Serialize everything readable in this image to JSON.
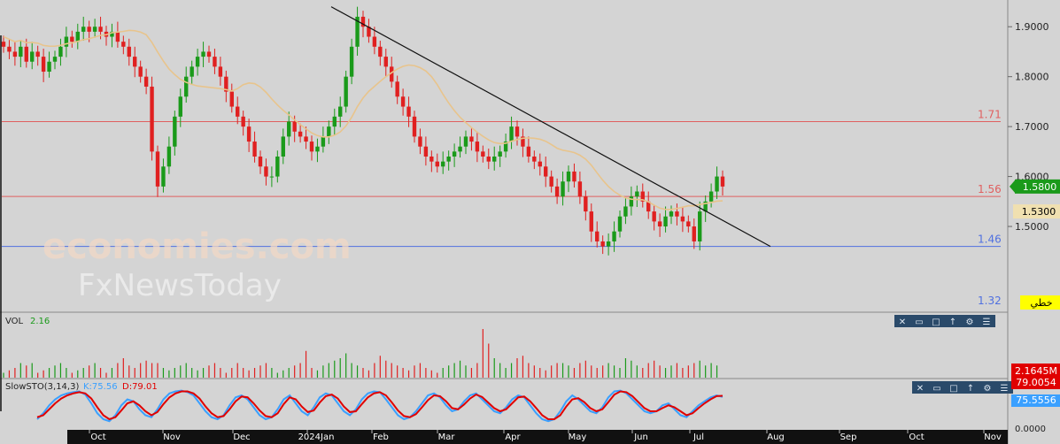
{
  "chart_data": {
    "type": "candlestick",
    "title": "",
    "price_axis": {
      "range": [
        1.33,
        1.95
      ],
      "ticks": [
        "1.9000",
        "1.8000",
        "1.7000",
        "1.6000",
        "1.5000"
      ],
      "tick_values": [
        1.9,
        1.8,
        1.7,
        1.6,
        1.5
      ]
    },
    "time_axis": {
      "labels": [
        "Oct",
        "Nov",
        "Dec",
        "2024Jan",
        "Feb",
        "Mar",
        "Apr",
        "May",
        "Jun",
        "Jul",
        "Aug",
        "Sep",
        "Oct",
        "Nov"
      ]
    },
    "candle_closes_approx": [
      1.86,
      1.85,
      1.84,
      1.86,
      1.83,
      1.85,
      1.84,
      1.81,
      1.83,
      1.84,
      1.86,
      1.88,
      1.87,
      1.89,
      1.9,
      1.89,
      1.9,
      1.89,
      1.88,
      1.89,
      1.87,
      1.86,
      1.84,
      1.82,
      1.8,
      1.78,
      1.65,
      1.58,
      1.62,
      1.66,
      1.72,
      1.76,
      1.8,
      1.82,
      1.84,
      1.85,
      1.84,
      1.82,
      1.8,
      1.77,
      1.74,
      1.72,
      1.7,
      1.67,
      1.64,
      1.62,
      1.6,
      1.6,
      1.64,
      1.68,
      1.71,
      1.69,
      1.68,
      1.67,
      1.65,
      1.66,
      1.68,
      1.7,
      1.72,
      1.74,
      1.8,
      1.86,
      1.92,
      1.9,
      1.88,
      1.86,
      1.84,
      1.82,
      1.79,
      1.76,
      1.74,
      1.72,
      1.68,
      1.66,
      1.64,
      1.63,
      1.62,
      1.63,
      1.64,
      1.65,
      1.66,
      1.68,
      1.67,
      1.65,
      1.64,
      1.63,
      1.64,
      1.65,
      1.67,
      1.7,
      1.68,
      1.66,
      1.64,
      1.63,
      1.62,
      1.6,
      1.58,
      1.56,
      1.59,
      1.61,
      1.59,
      1.56,
      1.53,
      1.49,
      1.47,
      1.46,
      1.47,
      1.49,
      1.52,
      1.54,
      1.56,
      1.57,
      1.55,
      1.53,
      1.51,
      1.5,
      1.52,
      1.53,
      1.52,
      1.51,
      1.5,
      1.47,
      1.53,
      1.55,
      1.57,
      1.6,
      1.58
    ],
    "moving_average_color": "#e8c48c",
    "horizontal_levels": [
      {
        "value": 1.71,
        "label": "1.71",
        "color": "#e06060"
      },
      {
        "value": 1.56,
        "label": "1.56",
        "color": "#e06060"
      },
      {
        "value": 1.46,
        "label": "1.46",
        "color": "#5070e0"
      },
      {
        "value": 1.32,
        "label": "1.32",
        "color": "#5070e0"
      }
    ],
    "trendline": {
      "from": {
        "month": "2024Jan",
        "price": 1.94
      },
      "to": {
        "month": "Aug",
        "price": 1.46
      }
    },
    "current_price": {
      "label": "1.5800",
      "bg": "#1a9a1a",
      "fg": "#ffffff"
    },
    "secondary_price": {
      "label": "1.5300",
      "bg": "#f0e0b0",
      "fg": "#000000"
    },
    "draw_tag": {
      "label": "خطي",
      "bg": "#ffff00",
      "fg": "#000000"
    },
    "volume": {
      "title": "VOL",
      "value": "2.16",
      "badge": {
        "label": "2.1645M",
        "bg": "#e00000",
        "fg": "#ffffff"
      },
      "values_approx": [
        0.1,
        0.15,
        0.2,
        0.3,
        0.25,
        0.3,
        0.1,
        0.15,
        0.2,
        0.25,
        0.3,
        0.2,
        0.1,
        0.15,
        0.2,
        0.25,
        0.3,
        0.2,
        0.1,
        0.2,
        0.3,
        0.4,
        0.25,
        0.2,
        0.3,
        0.35,
        0.3,
        0.3,
        0.2,
        0.15,
        0.2,
        0.25,
        0.3,
        0.2,
        0.15,
        0.2,
        0.25,
        0.3,
        0.2,
        0.1,
        0.2,
        0.3,
        0.2,
        0.15,
        0.2,
        0.25,
        0.3,
        0.2,
        0.1,
        0.15,
        0.2,
        0.25,
        0.3,
        0.55,
        0.2,
        0.15,
        0.25,
        0.3,
        0.35,
        0.4,
        0.5,
        0.3,
        0.25,
        0.2,
        0.15,
        0.3,
        0.45,
        0.35,
        0.3,
        0.25,
        0.2,
        0.15,
        0.25,
        0.3,
        0.2,
        0.15,
        0.1,
        0.2,
        0.25,
        0.3,
        0.35,
        0.25,
        0.2,
        0.3,
        1.0,
        0.7,
        0.4,
        0.3,
        0.2,
        0.3,
        0.4,
        0.45,
        0.3,
        0.25,
        0.2,
        0.15,
        0.25,
        0.3,
        0.3,
        0.25,
        0.2,
        0.3,
        0.35,
        0.25,
        0.2,
        0.25,
        0.3,
        0.25,
        0.2,
        0.4,
        0.35,
        0.25,
        0.2,
        0.3,
        0.35,
        0.25,
        0.2,
        0.25,
        0.3,
        0.2,
        0.25,
        0.3,
        0.35,
        0.25,
        0.3,
        0.25
      ],
      "label_zero": "0.0000"
    },
    "stochastic": {
      "title": "SlowSTO(3,14,3)",
      "k_label": "K:75.56",
      "d_label": "D:79.01",
      "k_color": "#3aa0ff",
      "d_color": "#e00000",
      "badge_d": {
        "label": "79.0054",
        "bg": "#e00000",
        "fg": "#ffffff"
      },
      "badge_k": {
        "label": "75.5556",
        "bg": "#3aa0ff",
        "fg": "#ffffff"
      },
      "k_values_approx": [
        20,
        35,
        55,
        70,
        80,
        85,
        88,
        90,
        82,
        60,
        35,
        20,
        15,
        30,
        55,
        70,
        65,
        45,
        30,
        25,
        45,
        70,
        85,
        90,
        92,
        88,
        80,
        60,
        40,
        25,
        20,
        30,
        55,
        75,
        80,
        70,
        50,
        30,
        20,
        25,
        45,
        70,
        80,
        60,
        40,
        30,
        50,
        75,
        85,
        80,
        60,
        40,
        30,
        45,
        70,
        85,
        90,
        88,
        70,
        50,
        30,
        20,
        25,
        40,
        60,
        80,
        85,
        75,
        55,
        40,
        45,
        65,
        80,
        85,
        70,
        55,
        40,
        35,
        50,
        70,
        80,
        75,
        55,
        35,
        20,
        15,
        20,
        40,
        65,
        80,
        70,
        55,
        40,
        35,
        50,
        75,
        90,
        92,
        85,
        70,
        55,
        40,
        35,
        40,
        55,
        60,
        45,
        30,
        25,
        40,
        55,
        65,
        75,
        80,
        76
      ],
      "d_values_approx": [
        25,
        30,
        45,
        60,
        72,
        80,
        85,
        88,
        85,
        72,
        50,
        30,
        20,
        25,
        42,
        60,
        65,
        55,
        40,
        30,
        38,
        58,
        75,
        85,
        90,
        90,
        85,
        72,
        52,
        35,
        25,
        28,
        45,
        65,
        77,
        75,
        60,
        42,
        28,
        25,
        35,
        58,
        75,
        70,
        52,
        38,
        42,
        62,
        78,
        82,
        72,
        52,
        38,
        40,
        58,
        75,
        85,
        88,
        80,
        62,
        42,
        28,
        25,
        33,
        50,
        68,
        80,
        78,
        65,
        48,
        45,
        57,
        72,
        82,
        76,
        62,
        48,
        40,
        45,
        60,
        75,
        77,
        65,
        48,
        30,
        20,
        20,
        30,
        52,
        70,
        73,
        63,
        48,
        40,
        45,
        63,
        82,
        90,
        88,
        78,
        63,
        48,
        40,
        40,
        48,
        55,
        50,
        40,
        30,
        35,
        48,
        60,
        70,
        78,
        79
      ]
    }
  },
  "watermark": {
    "line1": "economies.com",
    "line2": "FxNewsToday"
  },
  "panel_controls": [
    "close-icon",
    "window-icon",
    "maximize-icon",
    "arrow-up-icon",
    "settings-icon",
    "menu-icon"
  ]
}
